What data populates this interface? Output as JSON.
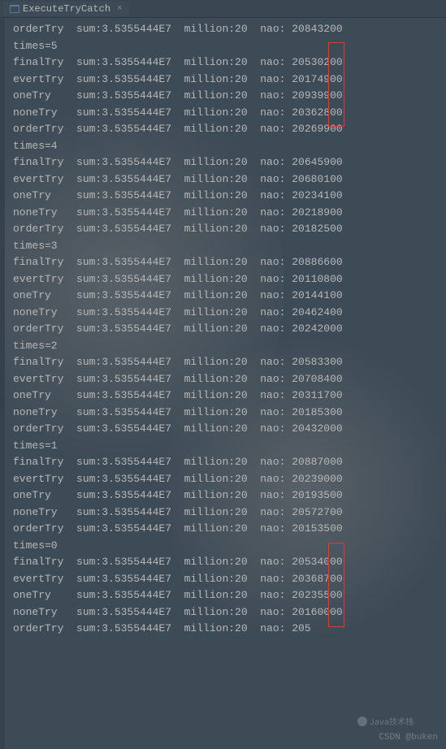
{
  "tab": {
    "title": "ExecuteTryCatch"
  },
  "console": {
    "lines": [
      {
        "label": "orderTry",
        "sum": "3.5355444E7",
        "million": "20",
        "nao": "20843200"
      },
      {
        "text": "times=5"
      },
      {
        "label": "finalTry",
        "sum": "3.5355444E7",
        "million": "20",
        "nao": "20530200"
      },
      {
        "label": "evertTry",
        "sum": "3.5355444E7",
        "million": "20",
        "nao": "20174900"
      },
      {
        "label": "oneTry",
        "sum": "3.5355444E7",
        "million": "20",
        "nao": "20939900"
      },
      {
        "label": "noneTry",
        "sum": "3.5355444E7",
        "million": "20",
        "nao": "20362800"
      },
      {
        "label": "orderTry",
        "sum": "3.5355444E7",
        "million": "20",
        "nao": "20269900"
      },
      {
        "text": "times=4"
      },
      {
        "label": "finalTry",
        "sum": "3.5355444E7",
        "million": "20",
        "nao": "20645900"
      },
      {
        "label": "evertTry",
        "sum": "3.5355444E7",
        "million": "20",
        "nao": "20680100"
      },
      {
        "label": "oneTry",
        "sum": "3.5355444E7",
        "million": "20",
        "nao": "20234100"
      },
      {
        "label": "noneTry",
        "sum": "3.5355444E7",
        "million": "20",
        "nao": "20218900"
      },
      {
        "label": "orderTry",
        "sum": "3.5355444E7",
        "million": "20",
        "nao": "20182500"
      },
      {
        "text": "times=3"
      },
      {
        "label": "finalTry",
        "sum": "3.5355444E7",
        "million": "20",
        "nao": "20886600"
      },
      {
        "label": "evertTry",
        "sum": "3.5355444E7",
        "million": "20",
        "nao": "20110800"
      },
      {
        "label": "oneTry",
        "sum": "3.5355444E7",
        "million": "20",
        "nao": "20144100"
      },
      {
        "label": "noneTry",
        "sum": "3.5355444E7",
        "million": "20",
        "nao": "20462400"
      },
      {
        "label": "orderTry",
        "sum": "3.5355444E7",
        "million": "20",
        "nao": "20242000"
      },
      {
        "text": "times=2"
      },
      {
        "label": "finalTry",
        "sum": "3.5355444E7",
        "million": "20",
        "nao": "20583300"
      },
      {
        "label": "evertTry",
        "sum": "3.5355444E7",
        "million": "20",
        "nao": "20708400"
      },
      {
        "label": "oneTry",
        "sum": "3.5355444E7",
        "million": "20",
        "nao": "20311700"
      },
      {
        "label": "noneTry",
        "sum": "3.5355444E7",
        "million": "20",
        "nao": "20185300"
      },
      {
        "label": "orderTry",
        "sum": "3.5355444E7",
        "million": "20",
        "nao": "20432000"
      },
      {
        "text": "times=1"
      },
      {
        "label": "finalTry",
        "sum": "3.5355444E7",
        "million": "20",
        "nao": "20887000"
      },
      {
        "label": "evertTry",
        "sum": "3.5355444E7",
        "million": "20",
        "nao": "20239000"
      },
      {
        "label": "oneTry",
        "sum": "3.5355444E7",
        "million": "20",
        "nao": "20193500"
      },
      {
        "label": "noneTry",
        "sum": "3.5355444E7",
        "million": "20",
        "nao": "20572700"
      },
      {
        "label": "orderTry",
        "sum": "3.5355444E7",
        "million": "20",
        "nao": "20153500"
      },
      {
        "text": "times=0"
      },
      {
        "label": "finalTry",
        "sum": "3.5355444E7",
        "million": "20",
        "nao": "20534000"
      },
      {
        "label": "evertTry",
        "sum": "3.5355444E7",
        "million": "20",
        "nao": "20368700"
      },
      {
        "label": "oneTry",
        "sum": "3.5355444E7",
        "million": "20",
        "nao": "20235500"
      },
      {
        "label": "noneTry",
        "sum": "3.5355444E7",
        "million": "20",
        "nao": "20160000"
      },
      {
        "label": "orderTry",
        "sum": "3.5355444E7",
        "million": "20",
        "nao": "205"
      }
    ]
  },
  "watermark": {
    "csdn": "CSDN @buken",
    "wechat": "Java技术栈"
  }
}
